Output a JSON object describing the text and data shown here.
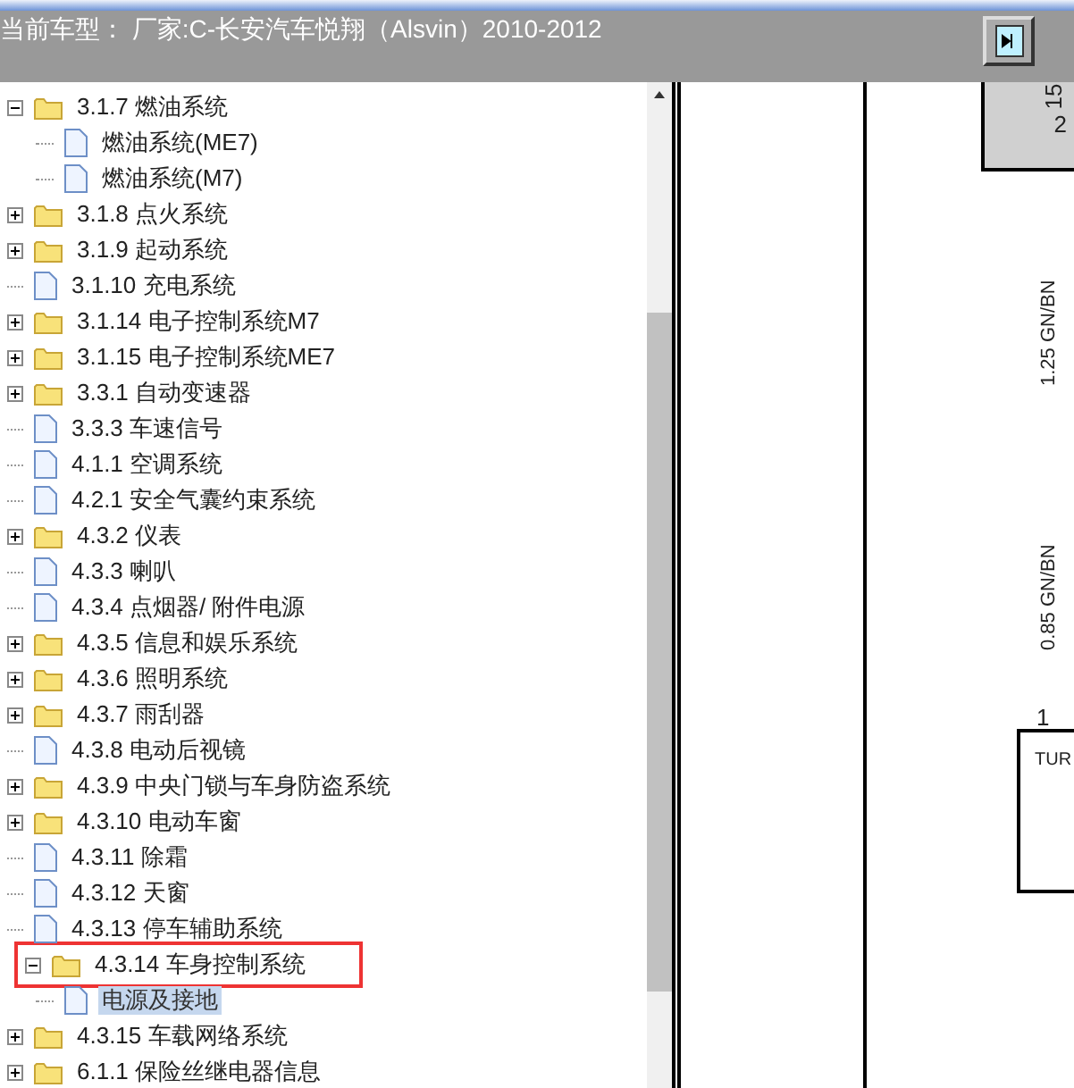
{
  "header": {
    "title": "当前车型： 厂家:C-长安汽车悦翔（Alsvin）2010-2012"
  },
  "tree": [
    {
      "kind": "folder",
      "label": "3.1.7 燃油系统",
      "expanded": true,
      "selected": false,
      "marked": false,
      "children": [
        {
          "kind": "doc",
          "label": "燃油系统(ME7)",
          "selected": false,
          "marked": false
        },
        {
          "kind": "doc",
          "label": "燃油系统(M7)",
          "selected": false,
          "marked": false
        }
      ]
    },
    {
      "kind": "folder",
      "label": "3.1.8 点火系统",
      "expanded": false,
      "selected": false,
      "marked": false
    },
    {
      "kind": "folder",
      "label": "3.1.9 起动系统",
      "expanded": false,
      "selected": false,
      "marked": false
    },
    {
      "kind": "doc",
      "label": "3.1.10 充电系统",
      "selected": false,
      "marked": false
    },
    {
      "kind": "folder",
      "label": "3.1.14 电子控制系统M7",
      "expanded": false,
      "selected": false,
      "marked": false
    },
    {
      "kind": "folder",
      "label": "3.1.15 电子控制系统ME7",
      "expanded": false,
      "selected": false,
      "marked": false
    },
    {
      "kind": "folder",
      "label": "3.3.1 自动变速器",
      "expanded": false,
      "selected": false,
      "marked": false
    },
    {
      "kind": "doc",
      "label": "3.3.3 车速信号",
      "selected": false,
      "marked": false
    },
    {
      "kind": "doc",
      "label": "4.1.1 空调系统",
      "selected": false,
      "marked": false
    },
    {
      "kind": "doc",
      "label": "4.2.1 安全气囊约束系统",
      "selected": false,
      "marked": false
    },
    {
      "kind": "folder",
      "label": "4.3.2 仪表",
      "expanded": false,
      "selected": false,
      "marked": false
    },
    {
      "kind": "doc",
      "label": "4.3.3 喇叭",
      "selected": false,
      "marked": false
    },
    {
      "kind": "doc",
      "label": "4.3.4 点烟器/ 附件电源",
      "selected": false,
      "marked": false
    },
    {
      "kind": "folder",
      "label": "4.3.5 信息和娱乐系统",
      "expanded": false,
      "selected": false,
      "marked": false
    },
    {
      "kind": "folder",
      "label": "4.3.6 照明系统",
      "expanded": false,
      "selected": false,
      "marked": false
    },
    {
      "kind": "folder",
      "label": "4.3.7 雨刮器",
      "expanded": false,
      "selected": false,
      "marked": false
    },
    {
      "kind": "doc",
      "label": "4.3.8 电动后视镜",
      "selected": false,
      "marked": false
    },
    {
      "kind": "folder",
      "label": "4.3.9 中央门锁与车身防盗系统",
      "expanded": false,
      "selected": false,
      "marked": false
    },
    {
      "kind": "folder",
      "label": "4.3.10 电动车窗",
      "expanded": false,
      "selected": false,
      "marked": false
    },
    {
      "kind": "doc",
      "label": "4.3.11 除霜",
      "selected": false,
      "marked": false
    },
    {
      "kind": "doc",
      "label": "4.3.12 天窗",
      "selected": false,
      "marked": false
    },
    {
      "kind": "doc",
      "label": "4.3.13 停车辅助系统",
      "selected": false,
      "marked": false
    },
    {
      "kind": "folder",
      "label": "4.3.14 车身控制系统",
      "expanded": true,
      "selected": false,
      "marked": true,
      "children": [
        {
          "kind": "doc",
          "label": "电源及接地",
          "selected": true,
          "marked": false
        }
      ]
    },
    {
      "kind": "folder",
      "label": "4.3.15 车载网络系统",
      "expanded": false,
      "selected": false,
      "marked": false
    },
    {
      "kind": "folder",
      "label": "6.1.1 保险丝继电器信息",
      "expanded": false,
      "selected": false,
      "marked": false
    }
  ],
  "diagram": {
    "pins": [
      "15",
      "2"
    ],
    "wires": [
      "1.25 GN/BN",
      "0.85 GN/BN"
    ],
    "connector_pin": "1",
    "module": "TUR"
  }
}
